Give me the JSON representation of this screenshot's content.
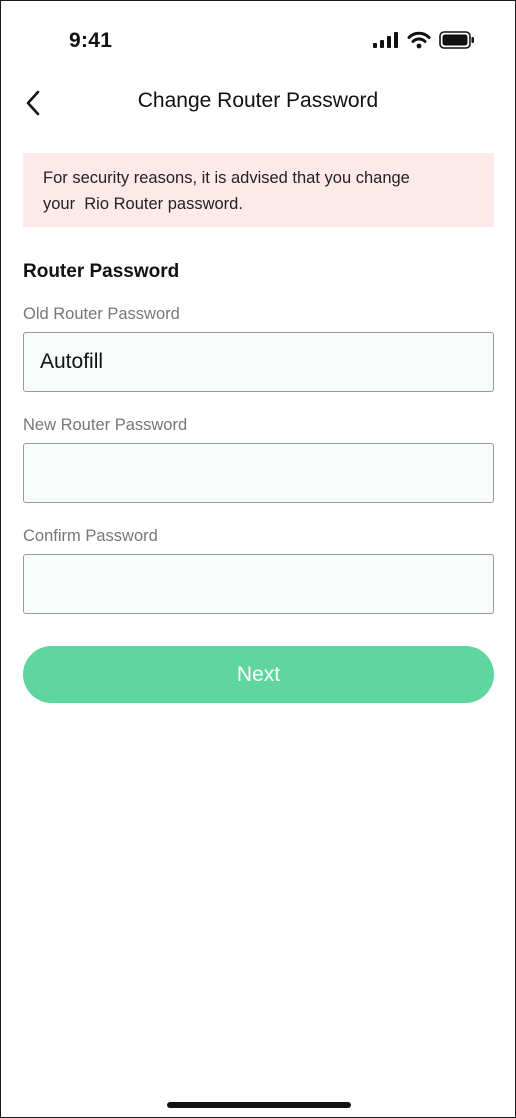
{
  "status_bar": {
    "time": "9:41",
    "icons": [
      "cellular-signal-icon",
      "wifi-icon",
      "battery-icon"
    ]
  },
  "header": {
    "back_icon": "chevron-left-icon",
    "title": "Change Router Password"
  },
  "alert": {
    "line1": "For security reasons, it is advised that you change",
    "line2": "your  Rio Router password.",
    "background_color": "#fde9e9"
  },
  "form": {
    "section_title": "Router Password",
    "old_password": {
      "label": "Old Router Password",
      "value": "Autofill"
    },
    "new_password": {
      "label": "New Router Password",
      "value": ""
    },
    "confirm_password": {
      "label": "Confirm Password",
      "value": ""
    }
  },
  "actions": {
    "next_label": "Next",
    "accent_color": "#5fd69e"
  }
}
